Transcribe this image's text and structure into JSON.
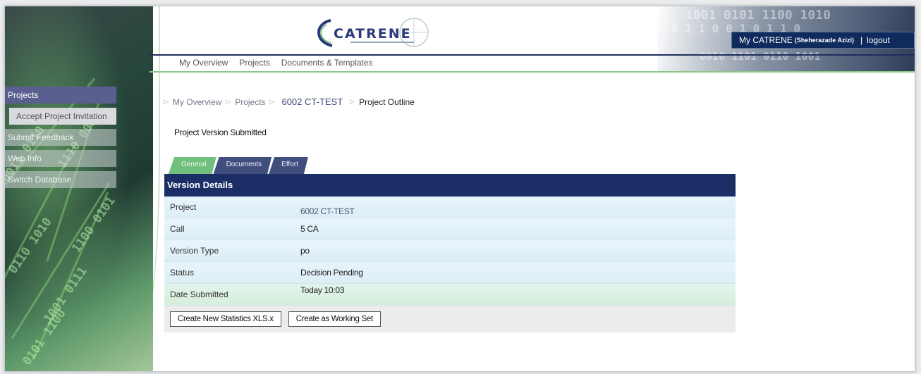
{
  "header": {
    "logo_text": "CATRENE",
    "user_label": "My CATRENE",
    "user_name": "(Sheherazade Azizi)",
    "separator": "|",
    "logout_label": "logout"
  },
  "top_nav": {
    "items": [
      {
        "label": "My Overview"
      },
      {
        "label": "Projects"
      },
      {
        "label": "Documents & Templates"
      }
    ]
  },
  "sidebar": {
    "items": [
      {
        "label": "Projects"
      },
      {
        "label": "Accept Project Invitation"
      },
      {
        "label": "Submit Feedback"
      },
      {
        "label": "Web Info"
      },
      {
        "label": "Switch Database"
      }
    ]
  },
  "breadcrumb": {
    "items": [
      {
        "label": "My Overview"
      },
      {
        "label": "Projects"
      },
      {
        "label": "6002 CT-TEST"
      },
      {
        "label": "Project Outline"
      }
    ]
  },
  "page": {
    "title": "Project Version Submitted"
  },
  "tabs": [
    {
      "label": "General"
    },
    {
      "label": "Documents"
    },
    {
      "label": "Effort"
    }
  ],
  "panel": {
    "header": "Version Details",
    "rows": [
      {
        "label": "Project",
        "value": "6002 CT-TEST"
      },
      {
        "label": "Call",
        "value": "5 CA"
      },
      {
        "label": "Version Type",
        "value": "po"
      },
      {
        "label": "Status",
        "value": "Decision Pending"
      },
      {
        "label": "Date Submitted",
        "value": "Today 10:03"
      }
    ],
    "buttons": {
      "create_stats": "Create New Statistics XLS.x",
      "create_working_set": "Create as Working Set"
    }
  },
  "colors": {
    "navy": "#1b2f66",
    "green_accent": "#72c07e",
    "sidebar_active": "#5b5f8f"
  }
}
